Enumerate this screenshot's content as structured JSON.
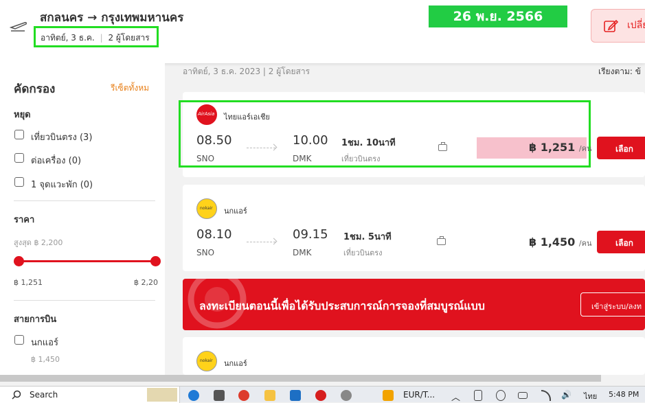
{
  "header": {
    "route": "สกลนคร → กรุงเทพมหานคร",
    "route_date": "อาทิตย์, 3 ธ.ค.",
    "route_sep": "|",
    "route_passengers": "2 ผู้โดยสาร",
    "date_badge": "26 พ.ย. 2566",
    "change_label": "เปลี่ย"
  },
  "sidebar": {
    "filter_title": "คัดกรอง",
    "reset_label": "รีเซ็ตทั้งหม",
    "stops_title": "หยุด",
    "stops": [
      {
        "label": "เที่ยวบินตรง (3)"
      },
      {
        "label": "ต่อเครื่อง (0)"
      },
      {
        "label": "1 จุดแวะพัก (0)"
      }
    ],
    "price_title": "ราคา",
    "price_max_label": "สูงสุด ฿ 2,200",
    "price_min_value": "฿ 1,251",
    "price_max_value": "฿ 2,20",
    "airlines_title": "สายการบิน",
    "airline_option": "นกแอร์",
    "airline_option_price": "฿ 1,450"
  },
  "results": {
    "summary": "อาทิตย์, 3 ธ.ค. 2023 | 2 ผู้โดยสาร",
    "sort_label": "เรียงตาม: ข้"
  },
  "flights": [
    {
      "airline": "ไทยแอร์เอเชีย",
      "logo_text": "AirAsia",
      "depart_time": "08.50",
      "depart_code": "SNO",
      "arrive_time": "10.00",
      "arrive_code": "DMK",
      "duration": "1ชม. 10นาที",
      "type": "เที่ยวบินตรง",
      "price": "฿ 1,251",
      "per": "/คน",
      "select": "เลือก"
    },
    {
      "airline": "นกแอร์",
      "logo_text": "nokair",
      "depart_time": "08.10",
      "depart_code": "SNO",
      "arrive_time": "09.15",
      "arrive_code": "DMK",
      "duration": "1ชม. 5นาที",
      "type": "เที่ยวบินตรง",
      "price": "฿ 1,450",
      "per": "/คน",
      "select": "เลือก"
    },
    {
      "airline": "นกแอร์",
      "logo_text": "nokair"
    }
  ],
  "banner": {
    "text": "ลงทะเบียนตอนนี้เพื่อได้รับประสบการณ์การจองที่สมบูรณ์แบบ",
    "button": "เข้าสู่ระบบ/ลงท"
  },
  "taskbar": {
    "search": "Search",
    "app_label": "EUR/T...",
    "lang": "ไทย",
    "time": "5:48 PM"
  },
  "colors": {
    "accent": "#e0121e",
    "highlight": "#22dd22",
    "badge": "#22cc44"
  }
}
